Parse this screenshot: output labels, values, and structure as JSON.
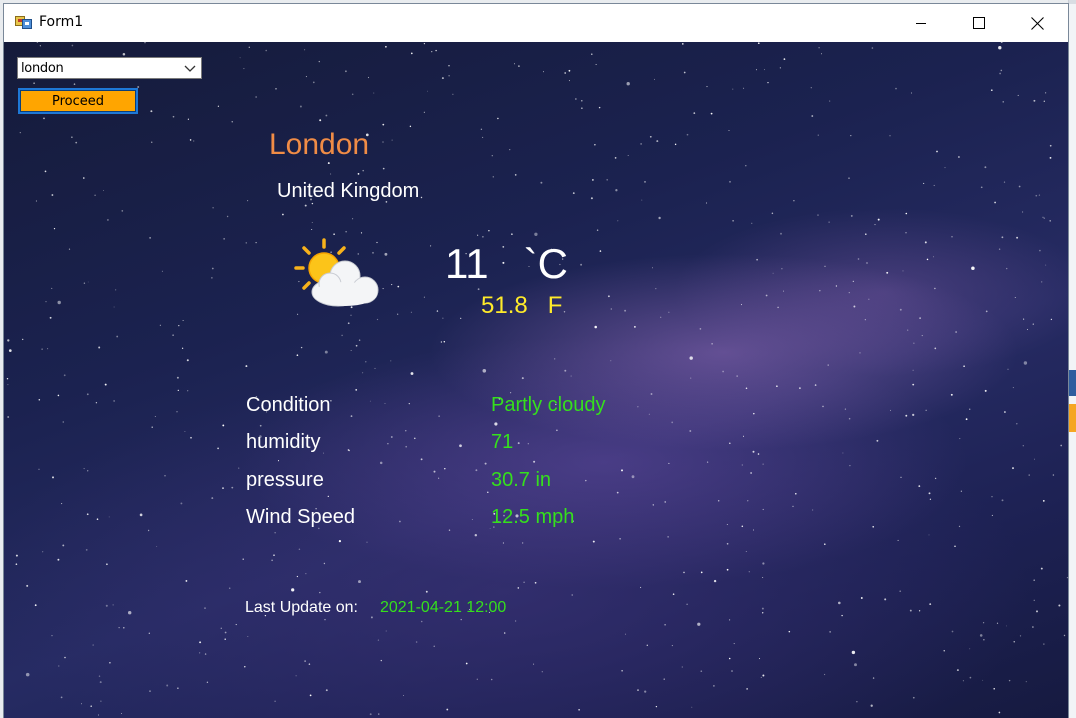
{
  "window": {
    "title": "Form1",
    "minimize_icon": "minimize-icon",
    "maximize_icon": "maximize-icon",
    "close_icon": "close-icon"
  },
  "form": {
    "city_select": {
      "value": "london",
      "options": [
        "london"
      ]
    },
    "proceed_label": "Proceed"
  },
  "weather": {
    "city": "London",
    "country": "United Kingdom",
    "icon": "partly-cloudy-icon",
    "temp_c": "11   `C",
    "temp_f": "51.8   F",
    "rows": [
      {
        "label": "Condition",
        "value": "Partly cloudy"
      },
      {
        "label": "humidity",
        "value": "71"
      },
      {
        "label": "pressure",
        "value": "30.7 in"
      },
      {
        "label": "Wind Speed",
        "value": "12.5 mph"
      }
    ],
    "last_update_label": "Last Update on:",
    "last_update_value": "2021-04-21 12:00"
  },
  "colors": {
    "city": "#f08c46",
    "temp_f": "#ffeb2a",
    "values": "#35e01c",
    "proceed_bg": "#ffa500"
  }
}
